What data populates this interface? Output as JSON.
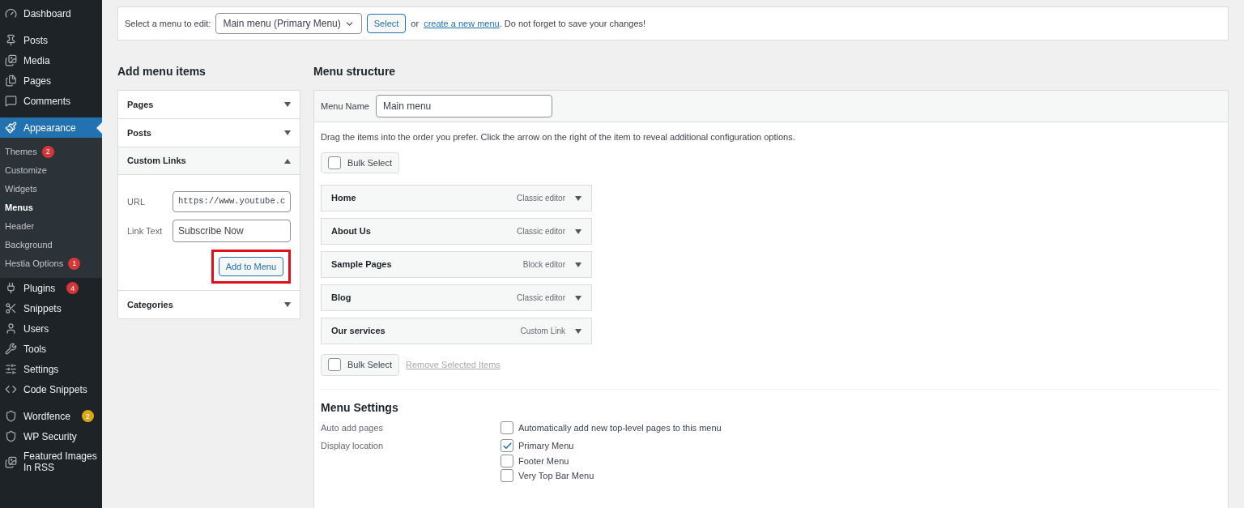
{
  "sidebar": {
    "groups": [
      {
        "items": [
          {
            "label": "Dashboard",
            "selected": false
          }
        ]
      },
      {
        "items": [
          {
            "label": "Posts",
            "selected": false
          },
          {
            "label": "Media",
            "selected": false
          },
          {
            "label": "Pages",
            "selected": false
          },
          {
            "label": "Comments",
            "selected": false
          }
        ]
      },
      {
        "items": [
          {
            "label": "Appearance",
            "selected": true,
            "children": [
              {
                "label": "Themes",
                "selected": false,
                "badge": {
                  "text": "2",
                  "color": "#d63638"
                }
              },
              {
                "label": "Customize",
                "selected": false
              },
              {
                "label": "Widgets",
                "selected": false
              },
              {
                "label": "Menus",
                "selected": true
              },
              {
                "label": "Header",
                "selected": false
              },
              {
                "label": "Background",
                "selected": false
              },
              {
                "label": "Hestia Options",
                "selected": false,
                "badge": {
                  "text": "1",
                  "color": "#d63638"
                }
              }
            ]
          },
          {
            "label": "Plugins",
            "selected": false,
            "badge": {
              "text": "4",
              "color": "#d63638"
            }
          },
          {
            "label": "Snippets",
            "selected": false
          },
          {
            "label": "Users",
            "selected": false
          },
          {
            "label": "Tools",
            "selected": false
          },
          {
            "label": "Settings",
            "selected": false
          },
          {
            "label": "Code Snippets",
            "selected": false
          }
        ]
      },
      {
        "items": [
          {
            "label": "Wordfence",
            "selected": false,
            "badge": {
              "text": "2",
              "color": "#dba617"
            }
          },
          {
            "label": "WP Security",
            "selected": false
          },
          {
            "label": "Featured Images In RSS",
            "selected": false
          }
        ]
      }
    ]
  },
  "select_bar": {
    "label": "Select a menu to edit:",
    "menu_select": "Main menu (Primary Menu)",
    "button": "Select",
    "or": "or",
    "link": "create a new menu",
    "note": ". Do not forget to save your changes!"
  },
  "add_items": {
    "title": "Add menu items",
    "sections": [
      {
        "title": "Pages",
        "expanded": false
      },
      {
        "title": "Posts",
        "expanded": false
      },
      {
        "title": "Custom Links",
        "expanded": true,
        "fields": [
          {
            "label": "URL",
            "value": "https://www.youtube.c",
            "mono": true
          },
          {
            "label": "Link Text",
            "value": "Subscribe Now",
            "mono": false
          }
        ],
        "button": "Add to Menu",
        "highlighted": true
      },
      {
        "title": "Categories",
        "expanded": false
      }
    ]
  },
  "structure": {
    "title": "Menu structure",
    "name_label": "Menu Name",
    "name_value": "Main menu",
    "hint": "Drag the items into the order you prefer. Click the arrow on the right of the item to reveal additional configuration options.",
    "bulk_select": {
      "label": "Bulk Select",
      "checked": false
    },
    "items": [
      {
        "title": "Home",
        "type": "Classic editor"
      },
      {
        "title": "About Us",
        "type": "Classic editor"
      },
      {
        "title": "Sample Pages",
        "type": "Block editor"
      },
      {
        "title": "Blog",
        "type": "Classic editor"
      },
      {
        "title": "Our services",
        "type": "Custom Link"
      }
    ],
    "bulk_select_bottom": {
      "label": "Bulk Select",
      "checked": false
    },
    "remove_link": "Remove Selected Items",
    "settings": {
      "title": "Menu Settings",
      "rows": [
        {
          "label": "Auto add pages",
          "options": [
            {
              "label": "Automatically add new top-level pages to this menu",
              "checked": false
            }
          ]
        },
        {
          "label": "Display location",
          "options": [
            {
              "label": "Primary Menu",
              "checked": true
            },
            {
              "label": "Footer Menu",
              "checked": false
            },
            {
              "label": "Very Top Bar Menu",
              "checked": false
            }
          ]
        }
      ]
    }
  }
}
